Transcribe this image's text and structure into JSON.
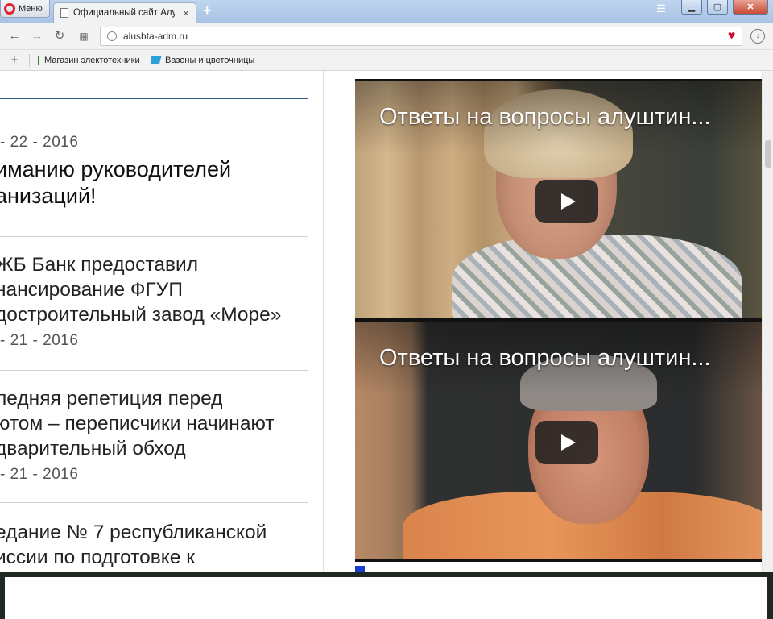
{
  "browser": {
    "menu_label": "Меню",
    "tab_title": "Официальный сайт Алушты",
    "tab_close": "×",
    "new_tab": "+",
    "url": "alushta-adm.ru",
    "bookmarks": [
      {
        "label": "Магазин электотехники",
        "icon": "plug-icon"
      },
      {
        "label": "Вазоны и цветочницы",
        "icon": "vase-icon"
      }
    ],
    "window_buttons": {
      "minimize": "▁",
      "maximize": "▢",
      "close": "✕"
    }
  },
  "news": [
    {
      "date": "- 22 - 2016",
      "title_lines": [
        "иманию руководителей",
        "анизаций!"
      ]
    },
    {
      "title_lines": [
        "ЖБ Банк предоставил",
        "нансирование ФГУП",
        "достроительный завод «Море»"
      ],
      "date": "- 21 - 2016"
    },
    {
      "title_lines": [
        "ледняя репетиция перед",
        "ютом – переписчики начинают",
        "дварительный обход"
      ],
      "date": "- 21 - 2016"
    },
    {
      "title_lines": [
        "едание № 7 республиканской",
        "иссии по подготовке к"
      ]
    }
  ],
  "videos": [
    {
      "title": "Ответы на вопросы алуштин..."
    },
    {
      "title": "Ответы на вопросы алуштин..."
    }
  ],
  "colors": {
    "accent_line": "#2f5c8a",
    "heart": "#c8102e",
    "opera_red": "#e0232e"
  }
}
